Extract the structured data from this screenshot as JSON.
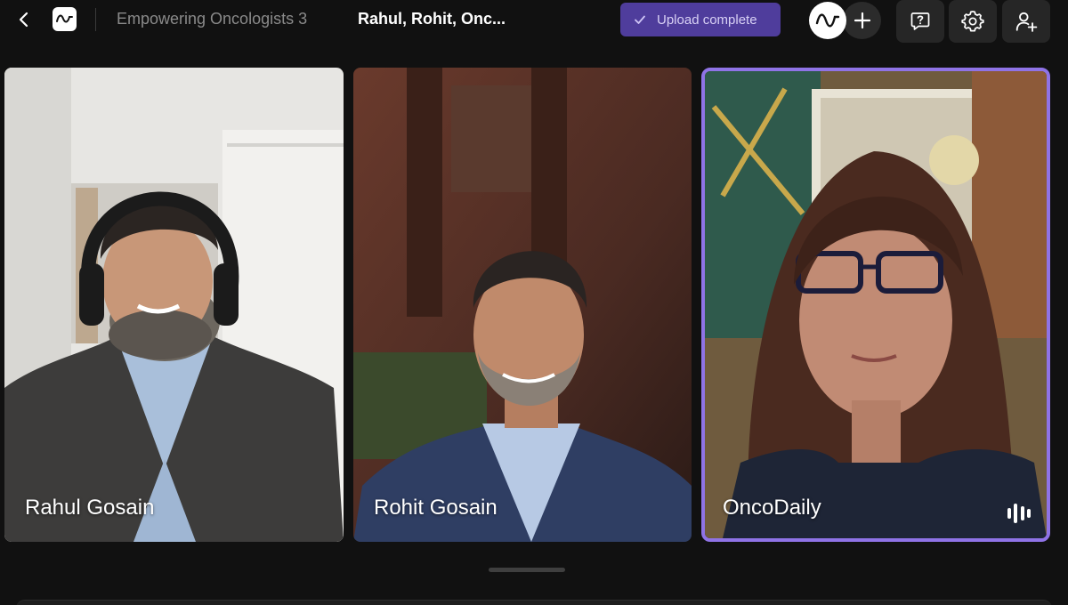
{
  "header": {
    "project_title": "Empowering Oncologists 3",
    "session_title": "Rahul, Rohit, Onc...",
    "upload_status": "Upload complete",
    "icons": {
      "back": "chevron-left-icon",
      "logo": "waveform-logo-icon",
      "check": "check-icon",
      "add": "plus-icon",
      "help": "help-message-icon",
      "settings": "gear-icon",
      "invite": "user-plus-icon"
    }
  },
  "participants": [
    {
      "name": "Rahul Gosain",
      "speaking": false
    },
    {
      "name": "Rohit Gosain",
      "speaking": false
    },
    {
      "name": "OncoDaily",
      "speaking": true
    }
  ],
  "colors": {
    "background": "#111111",
    "accent": "#8f73e6",
    "upload_pill": "#4f3d9c",
    "button": "#262626"
  }
}
